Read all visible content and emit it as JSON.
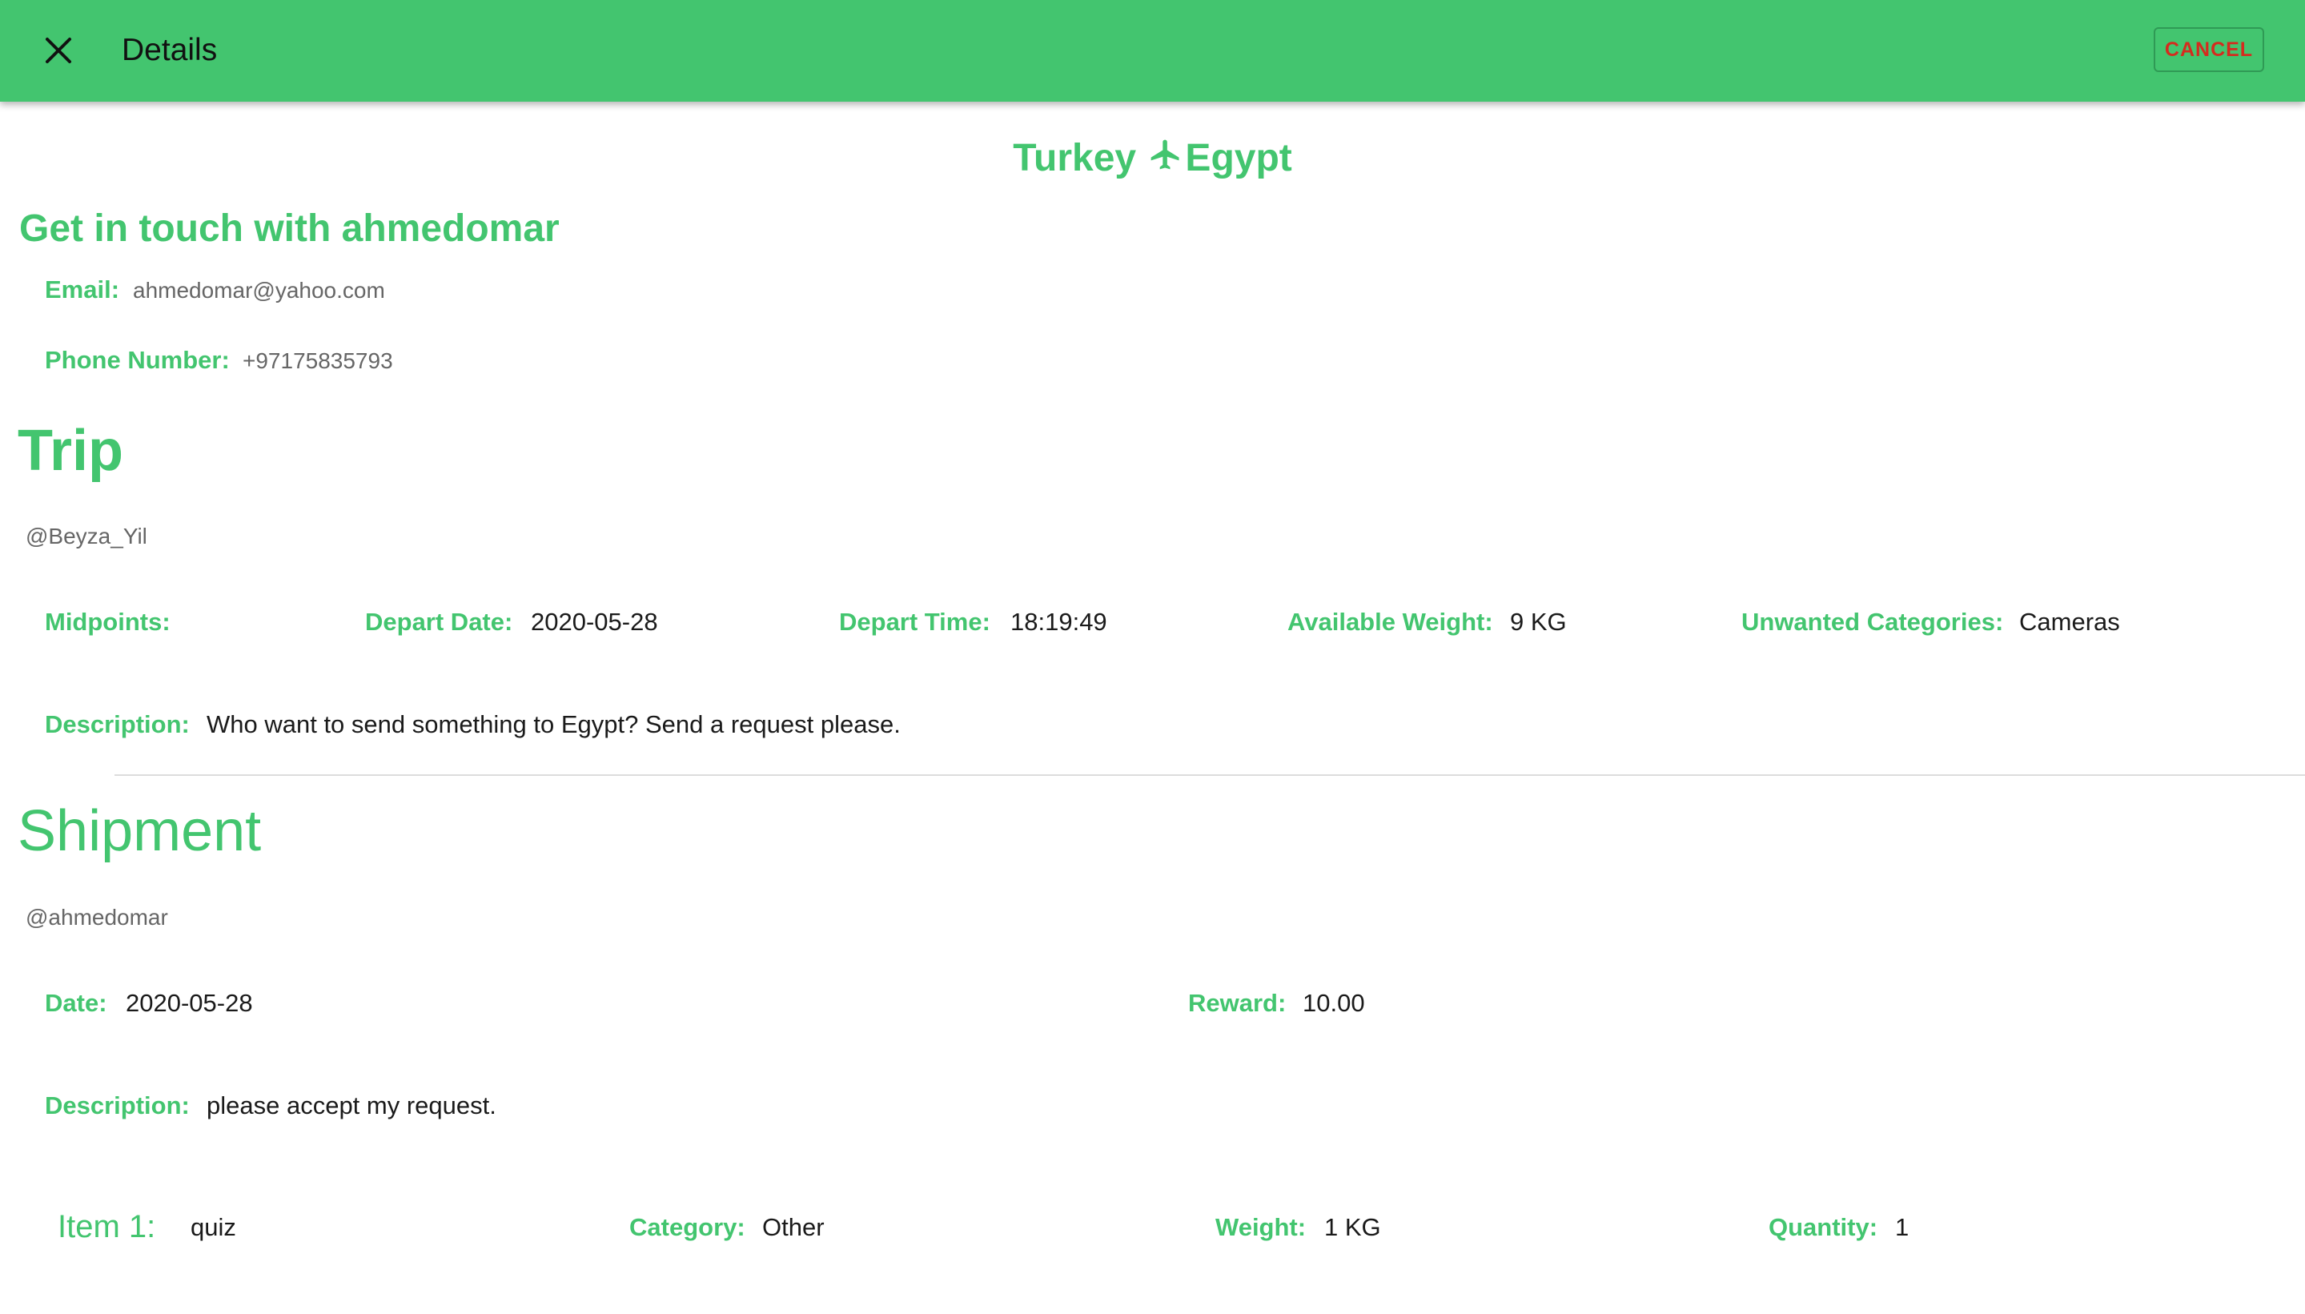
{
  "appbar": {
    "title": "Details",
    "cancel_label": "CANCEL",
    "close_icon": "close-icon"
  },
  "route": {
    "from": "Turkey",
    "to": "Egypt",
    "icon": "airplane-icon"
  },
  "contact": {
    "heading": "Get in touch with ahmedomar",
    "email_label": "Email:",
    "email": "ahmedomar@yahoo.com",
    "phone_label": "Phone Number:",
    "phone": "+97175835793"
  },
  "trip": {
    "heading": "Trip",
    "user": "@Beyza_Yil",
    "midpoints_label": "Midpoints:",
    "midpoints": "",
    "depart_date_label": "Depart Date:",
    "depart_date": "2020-05-28",
    "depart_time_label": "Depart Time:",
    "depart_time": "18:19:49",
    "available_weight_label": "Available Weight:",
    "available_weight": "9 KG",
    "unwanted_label": "Unwanted Categories:",
    "unwanted": "Cameras",
    "description_label": "Description:",
    "description": "Who want to send something to Egypt? Send a request please."
  },
  "shipment": {
    "heading": "Shipment",
    "user": "@ahmedomar",
    "date_label": "Date:",
    "date": "2020-05-28",
    "reward_label": "Reward:",
    "reward": "10.00",
    "description_label": "Description:",
    "description": "please accept my request.",
    "items": [
      {
        "label": "Item 1:",
        "name": "quiz",
        "category_label": "Category:",
        "category": "Other",
        "weight_label": "Weight:",
        "weight": "1 KG",
        "quantity_label": "Quantity:",
        "quantity": "1"
      }
    ]
  },
  "colors": {
    "brand_green": "#43c56f",
    "cancel_red": "#d52b1e"
  }
}
